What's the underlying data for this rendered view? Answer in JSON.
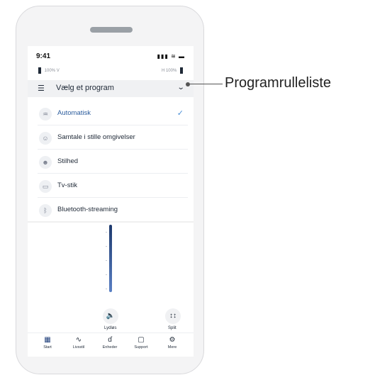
{
  "status": {
    "time": "9:41",
    "icons": "▮▮▮ ≋ ▬"
  },
  "battery": {
    "left_pct": "100%",
    "left_side": "V",
    "right_side": "H",
    "right_pct": "100%"
  },
  "dropdown": {
    "title": "Vælg et program",
    "list_icon": "☰",
    "chevron": "⌄"
  },
  "programs": [
    {
      "label": "Automatisk",
      "icon": "♒",
      "selected": true,
      "check": "✓"
    },
    {
      "label": "Samtale i stille omgivelser",
      "icon": "☺"
    },
    {
      "label": "Stilhed",
      "icon": "☻"
    },
    {
      "label": "Tv-stik",
      "icon": "▭"
    },
    {
      "label": "Bluetooth-streaming",
      "icon": "ᛒ"
    }
  ],
  "actions": {
    "mute": {
      "label": "Lydløs",
      "icon": "🔈"
    },
    "split": {
      "label": "Split",
      "icon": "↕↕"
    }
  },
  "nav": [
    {
      "label": "Start",
      "icon": "▦"
    },
    {
      "label": "Livsstil",
      "icon": "∿"
    },
    {
      "label": "Enheder",
      "icon": "ɗ"
    },
    {
      "label": "Support",
      "icon": "▢"
    },
    {
      "label": "Mere",
      "icon": "⚙"
    }
  ],
  "callout": {
    "label": "Programrulleliste"
  }
}
